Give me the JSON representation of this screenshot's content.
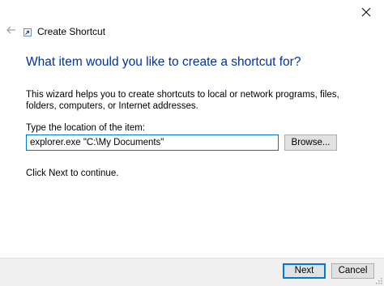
{
  "window": {
    "title": "Create Shortcut",
    "back_icon": "back-arrow-icon",
    "app_icon": "shortcut-icon",
    "close_icon": "close-icon"
  },
  "content": {
    "heading": "What item would you like to create a shortcut for?",
    "description": "This wizard helps you to create shortcuts to local or network programs, files, folders, computers, or Internet addresses.",
    "location_label": "Type the location of the item:",
    "location_value": "explorer.exe \"C:\\My Documents\"",
    "browse_label": "Browse...",
    "continue_text": "Click Next to continue."
  },
  "footer": {
    "next_label": "Next",
    "cancel_label": "Cancel"
  },
  "colors": {
    "heading": "#003399",
    "focus_border": "#0078d7",
    "footer_bg": "#f0f0f0"
  }
}
